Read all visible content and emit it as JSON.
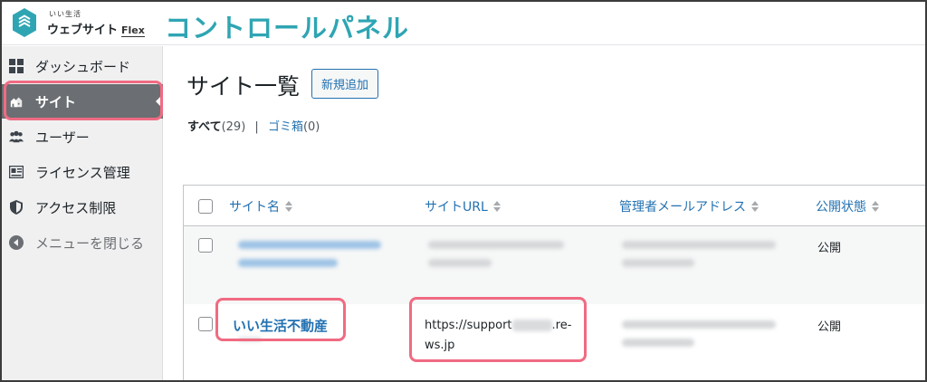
{
  "header": {
    "logo_small": "いい生活",
    "logo_main": "ウェブサイト",
    "logo_flex": "Flex",
    "panel_title": "コントロールパネル"
  },
  "sidebar": {
    "items": [
      {
        "label": "ダッシュボード",
        "icon": "dashboard-icon"
      },
      {
        "label": "サイト",
        "icon": "sites-icon"
      },
      {
        "label": "ユーザー",
        "icon": "users-icon"
      },
      {
        "label": "ライセンス管理",
        "icon": "license-icon"
      },
      {
        "label": "アクセス制限",
        "icon": "shield-icon"
      },
      {
        "label": "メニューを閉じる",
        "icon": "collapse-icon"
      }
    ]
  },
  "main": {
    "heading": "サイト一覧",
    "add_new": "新規追加",
    "filters": {
      "all_label": "すべて",
      "all_count": "(29)",
      "separator": "|",
      "trash_label": "ゴミ箱",
      "trash_count": "(0)"
    }
  },
  "table": {
    "columns": [
      "サイト名",
      "サイトURL",
      "管理者メールアドレス",
      "公開状態"
    ],
    "rows": [
      {
        "status": "公開"
      },
      {
        "site_name": "いい生活不動産",
        "url_start": "https://support",
        "url_end": ".re-ws.jp",
        "status": "公開"
      }
    ]
  },
  "colors": {
    "accent": "#2fa5b3",
    "link": "#2271b1",
    "highlight": "#f06b82",
    "sidebar_active": "#6b6e72"
  }
}
